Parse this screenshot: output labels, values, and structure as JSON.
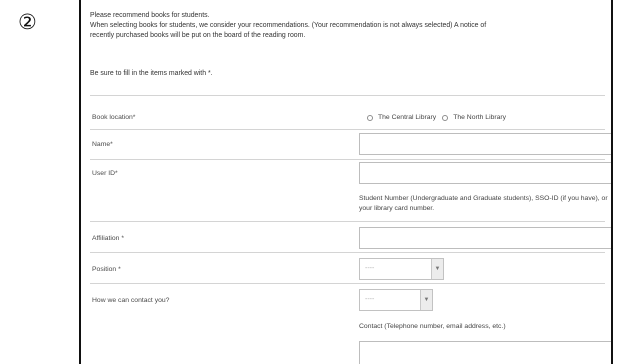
{
  "step_marker": "②",
  "intro": {
    "line1": "Please recommend books for students.",
    "line2": "When selecting books for students, we consider your recommendations. (Your recommendation is not always selected) A notice of",
    "line3": "recently purchased books will be put on the board of the reading room."
  },
  "required_note": "Be sure to fill in the items marked with *.",
  "form": {
    "book_location": {
      "label": "Book location*",
      "options": [
        "The Central Library",
        "The North Library"
      ]
    },
    "name": {
      "label": "Name*",
      "value": ""
    },
    "user_id": {
      "label": "User ID*",
      "value": "",
      "hint": "Student Number (Undergraduate and Graduate students), SSO-ID (if you have), or your library card number."
    },
    "affiliation": {
      "label": "Affiliation *",
      "value": ""
    },
    "position": {
      "label": "Position *",
      "selected": "----"
    },
    "contact_method": {
      "label": "How we can contact you?",
      "selected": "----"
    },
    "contact": {
      "hint": "Contact (Telephone number, email address, etc.)",
      "value": ""
    }
  }
}
